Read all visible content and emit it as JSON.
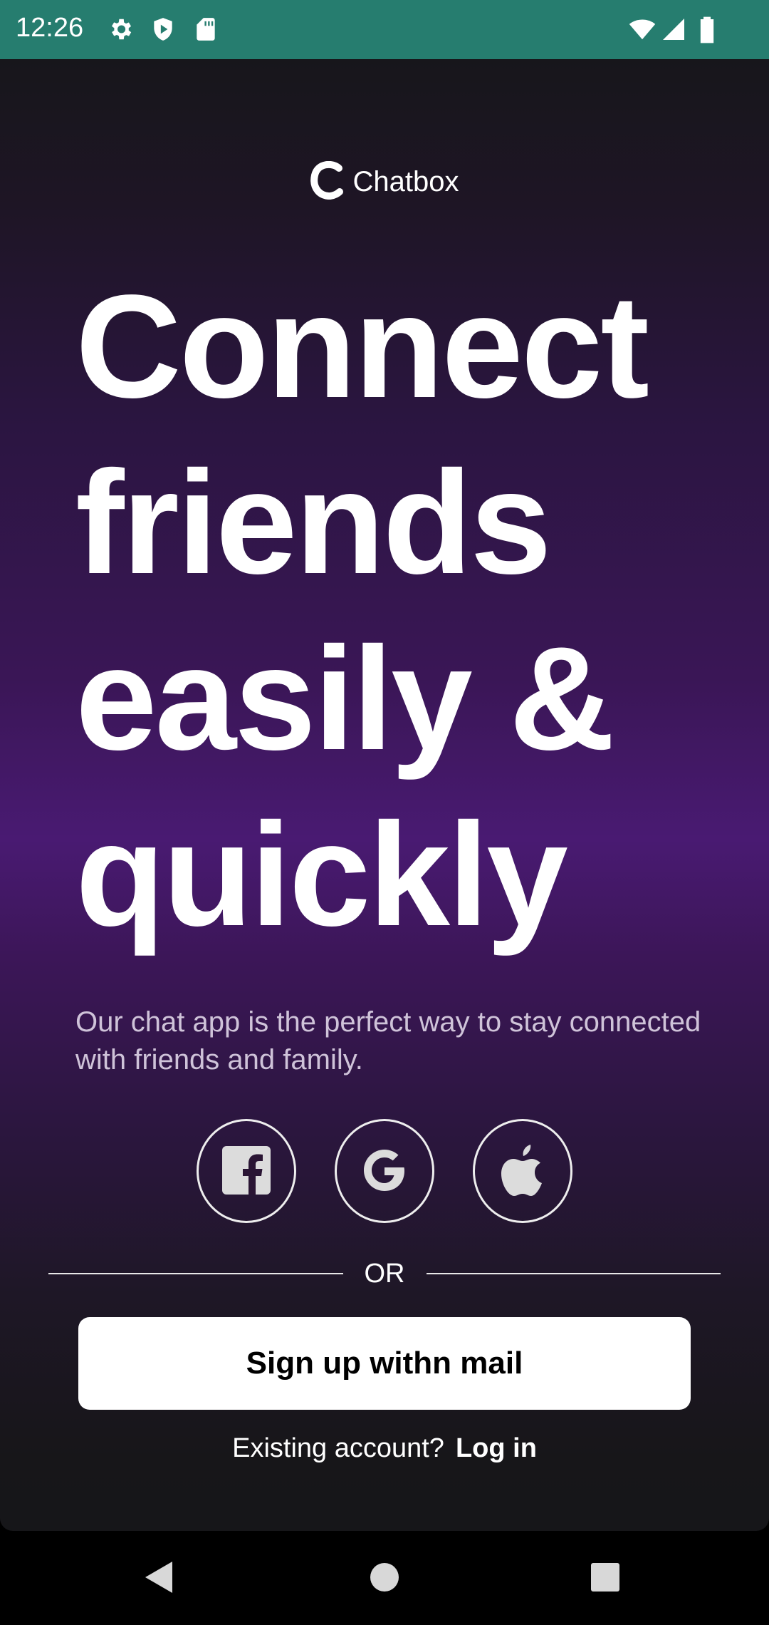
{
  "status_bar": {
    "time": "12:26",
    "icons": [
      "gear-icon",
      "shield-play-icon",
      "sd-card-icon",
      "wifi-icon",
      "signal-icon",
      "battery-icon"
    ]
  },
  "app": {
    "brand_name": "Chatbox",
    "headline_lines": [
      "Connect",
      "friends",
      "easily &",
      "quickly"
    ],
    "subtitle": "Our chat app is the perfect way to stay connected with friends and family.",
    "social_buttons": [
      "facebook-icon",
      "google-icon",
      "apple-icon"
    ],
    "divider_text": "OR",
    "signup_label": "Sign up withn mail",
    "login_prompt": "Existing account?",
    "login_link": "Log in"
  },
  "nav_bar": {
    "buttons": [
      "back-icon",
      "home-icon",
      "recents-icon"
    ]
  },
  "colors": {
    "status_bar_bg": "#267d6f",
    "gradient_top": "#17161b",
    "gradient_mid": "#491a72",
    "gradient_bottom": "#161619",
    "text_primary": "#ffffff",
    "button_bg": "#ffffff"
  }
}
